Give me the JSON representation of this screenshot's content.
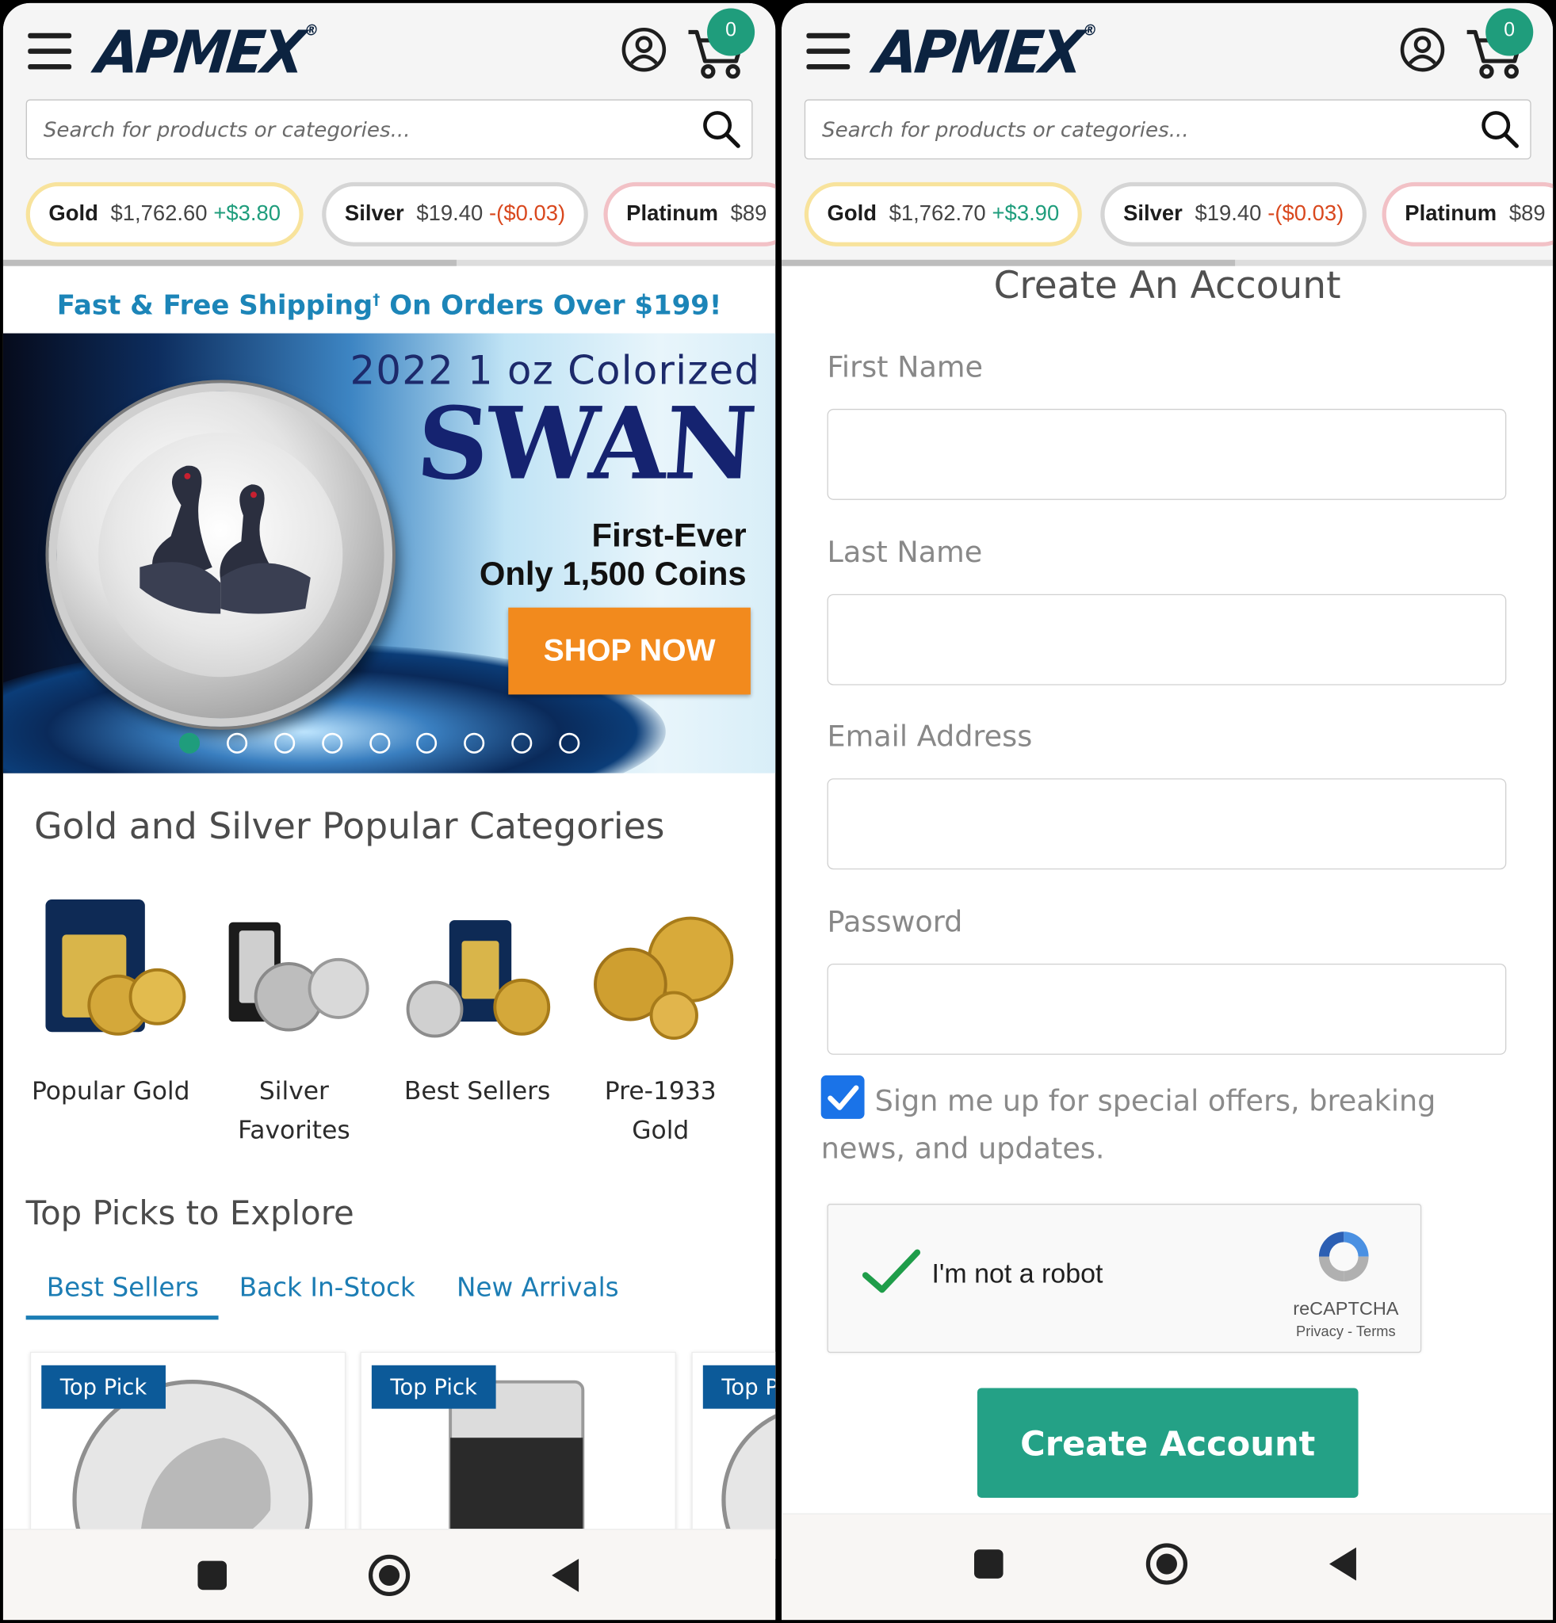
{
  "brand": {
    "logo_text": "APMEX",
    "logo_mark": "®"
  },
  "header": {
    "cart_count": "0",
    "search_placeholder": "Search for products or categories..."
  },
  "left": {
    "tickers": [
      {
        "metal": "Gold",
        "price": "$1,762.60",
        "change": "+$3.80",
        "direction": "up"
      },
      {
        "metal": "Silver",
        "price": "$19.40",
        "change": "-($0.03)",
        "direction": "down"
      },
      {
        "metal": "Platinum",
        "price": "$89",
        "change": "",
        "direction": ""
      }
    ],
    "shipping_banner": {
      "text_before": "Fast & Free Shipping",
      "dagger": "†",
      "text_after": " On Orders Over $199!"
    },
    "hero": {
      "title_line": "2022 1 oz Colorized",
      "title_main": "SWAN",
      "sub_line1": "First-Ever",
      "sub_line2": "Only 1,500 Coins",
      "cta_label": "SHOP NOW",
      "slide_count": 9,
      "active_slide": 1
    },
    "popular_title": "Gold and Silver Popular Categories",
    "categories": [
      {
        "label": "Popular Gold",
        "icon": "gold-bar-and-coins-icon"
      },
      {
        "label": "Silver Favorites",
        "icon": "silver-bar-and-coins-icon"
      },
      {
        "label": "Best Sellers",
        "icon": "mixed-bullion-icon"
      },
      {
        "label": "Pre-1933 Gold",
        "icon": "gold-coins-icon"
      }
    ],
    "toppicks_title": "Top Picks to Explore",
    "tabs": [
      {
        "label": "Best Sellers",
        "active": true
      },
      {
        "label": "Back In-Stock",
        "active": false
      },
      {
        "label": "New Arrivals",
        "active": false
      }
    ],
    "product_cards": [
      {
        "badge": "Top Pick",
        "image": "silver-buffalo-round-icon"
      },
      {
        "badge": "Top Pick",
        "image": "silver-bar-icon"
      },
      {
        "badge": "Top Pick",
        "image": "silver-coin-icon"
      }
    ]
  },
  "right": {
    "tickers": [
      {
        "metal": "Gold",
        "price": "$1,762.70",
        "change": "+$3.90",
        "direction": "up"
      },
      {
        "metal": "Silver",
        "price": "$19.40",
        "change": "-($0.03)",
        "direction": "down"
      },
      {
        "metal": "Platinum",
        "price": "$89",
        "change": "",
        "direction": ""
      }
    ],
    "form_title": "Create An Account",
    "fields": [
      {
        "label": "First Name",
        "value": ""
      },
      {
        "label": "Last Name",
        "value": ""
      },
      {
        "label": "Email Address",
        "value": ""
      },
      {
        "label": "Password",
        "value": ""
      }
    ],
    "optin": {
      "checked": true,
      "text": "Sign me up for special offers, breaking news, and updates."
    },
    "captcha": {
      "label": "I'm not a robot",
      "brand": "reCAPTCHA",
      "links": "Privacy - Terms",
      "checked": true
    },
    "submit_label": "Create Account"
  },
  "colors": {
    "brand_navy": "#0c2340",
    "accent_green": "#1f9d7c",
    "link_blue": "#1c7db4",
    "cta_orange": "#f28a1d",
    "badge_blue": "#0c5a99",
    "price_up": "#1f9d7c",
    "price_down": "#d9481e"
  },
  "system_nav": {
    "buttons": [
      "recents-square-icon",
      "home-circle-icon",
      "back-triangle-icon"
    ]
  }
}
